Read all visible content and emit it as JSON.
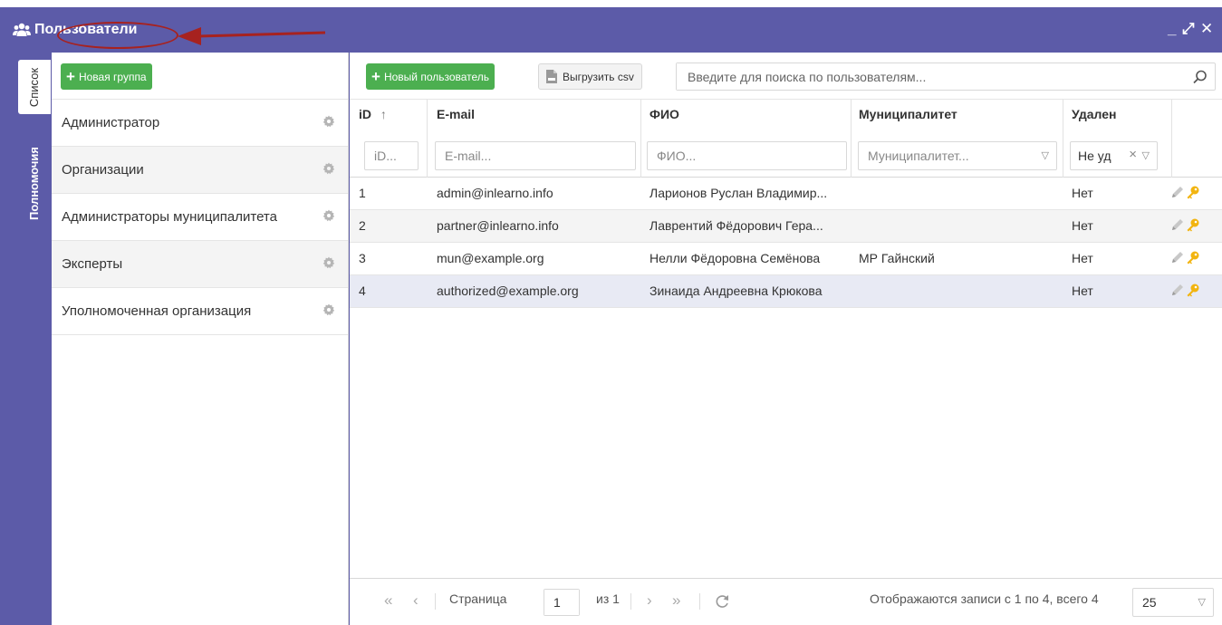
{
  "window": {
    "title": "Пользователи",
    "minimize": "_",
    "maximize": "⤢",
    "close": "✕"
  },
  "tabs": [
    {
      "label": "Список",
      "active": true
    },
    {
      "label": "Полномочия",
      "active": false
    }
  ],
  "left": {
    "new_group": "Новая группа",
    "groups": [
      {
        "label": "Администратор"
      },
      {
        "label": "Организации"
      },
      {
        "label": "Администраторы муниципалитета"
      },
      {
        "label": "Эксперты"
      },
      {
        "label": "Уполномоченная организация"
      }
    ]
  },
  "toolbar": {
    "new_user": "Новый пользователь",
    "export_csv": "Выгрузить csv",
    "search_placeholder": "Введите для поиска по пользователям..."
  },
  "grid": {
    "columns": {
      "id": "iD",
      "email": "E-mail",
      "fio": "ФИО",
      "municipality": "Муниципалитет",
      "deleted": "Удален"
    },
    "sort_indicator": "↑",
    "filters": {
      "id_placeholder": "iD...",
      "email_placeholder": "E-mail...",
      "fio_placeholder": "ФИО...",
      "municipality_placeholder": "Муниципалитет...",
      "deleted_value": "Не уд"
    },
    "rows": [
      {
        "id": "1",
        "email": "admin@inlearno.info",
        "fio": "Ларионов Руслан Владимир...",
        "municipality": "",
        "deleted": "Нет"
      },
      {
        "id": "2",
        "email": "partner@inlearno.info",
        "fio": "Лаврентий Фёдорович Гера...",
        "municipality": "",
        "deleted": "Нет"
      },
      {
        "id": "3",
        "email": "mun@example.org",
        "fio": "Нелли Фёдоровна Семёнова",
        "municipality": "МР Гайнский",
        "deleted": "Нет"
      },
      {
        "id": "4",
        "email": "authorized@example.org",
        "fio": "Зинаида Андреевна Крюкова",
        "municipality": "",
        "deleted": "Нет"
      }
    ]
  },
  "pager": {
    "page_label": "Страница",
    "page_value": "1",
    "of_label": "из 1",
    "status": "Отображаются записи с 1 по 4, всего 4",
    "page_size": "25"
  },
  "colors": {
    "header": "#5c5ba8",
    "green": "#4caf50",
    "annotation": "#a7221f",
    "key": "#f2b40f"
  }
}
